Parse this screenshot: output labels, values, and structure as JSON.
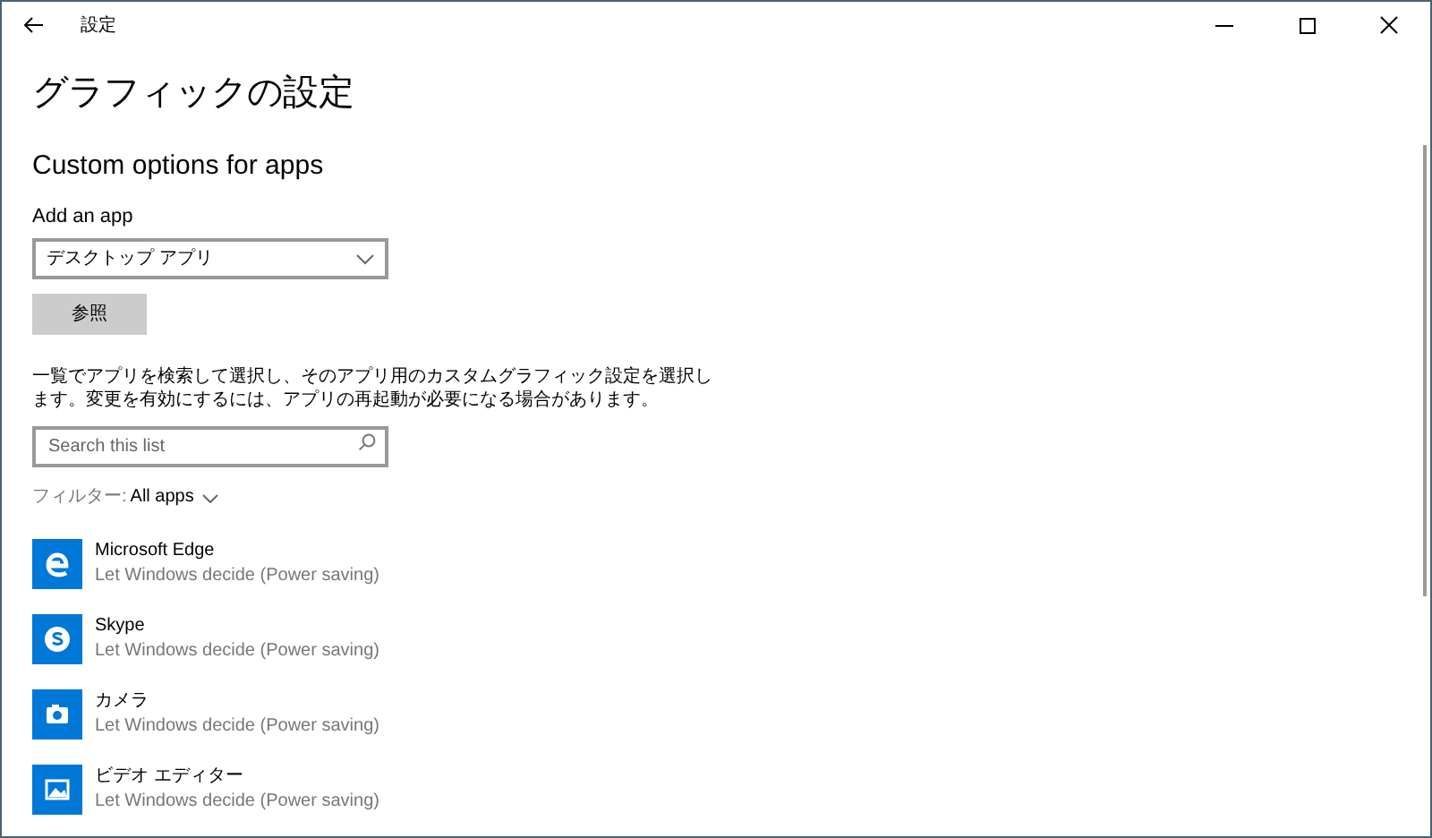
{
  "window": {
    "title": "設定"
  },
  "page_title": "グラフィックの設定",
  "section_title": "Custom options for apps",
  "add_app": {
    "label": "Add an app",
    "dropdown_value": "デスクトップ アプリ",
    "browse_button": "参照"
  },
  "description": "一覧でアプリを検索して選択し、そのアプリ用のカスタムグラフィック設定を選択します。変更を有効にするには、アプリの再起動が必要になる場合があります。",
  "search": {
    "placeholder": "Search this list"
  },
  "filter": {
    "label": "フィルター:",
    "value": "All apps"
  },
  "apps": [
    {
      "name": "Microsoft Edge",
      "setting": "Let Windows decide (Power saving)",
      "kind": "edge"
    },
    {
      "name": "Skype",
      "setting": "Let Windows decide (Power saving)",
      "kind": "skype"
    },
    {
      "name": "カメラ",
      "setting": "Let Windows decide (Power saving)",
      "kind": "camera"
    },
    {
      "name": "ビデオ エディター",
      "setting": "Let Windows decide (Power saving)",
      "kind": "video"
    }
  ]
}
